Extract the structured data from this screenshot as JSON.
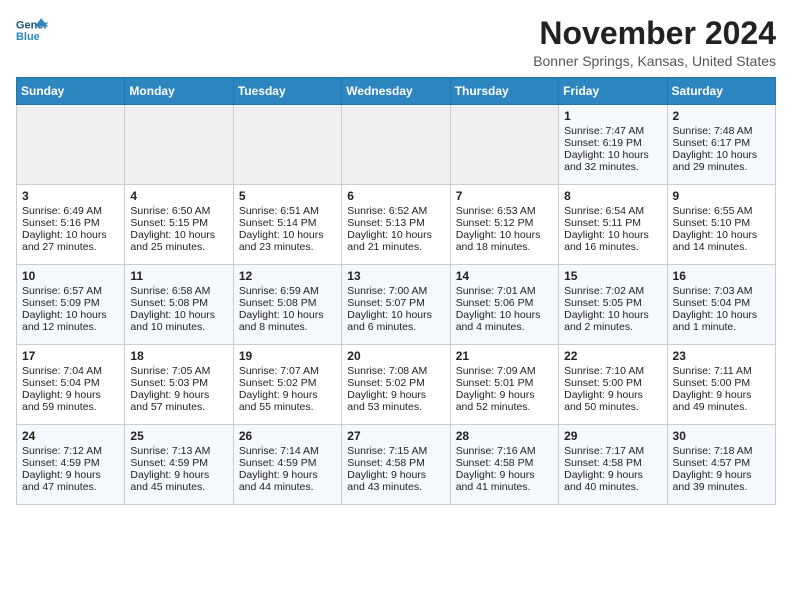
{
  "logo": {
    "line1": "General",
    "line2": "Blue"
  },
  "title": "November 2024",
  "location": "Bonner Springs, Kansas, United States",
  "days_of_week": [
    "Sunday",
    "Monday",
    "Tuesday",
    "Wednesday",
    "Thursday",
    "Friday",
    "Saturday"
  ],
  "weeks": [
    [
      {
        "day": "",
        "empty": true
      },
      {
        "day": "",
        "empty": true
      },
      {
        "day": "",
        "empty": true
      },
      {
        "day": "",
        "empty": true
      },
      {
        "day": "",
        "empty": true
      },
      {
        "day": "1",
        "sunrise": "Sunrise: 7:47 AM",
        "sunset": "Sunset: 6:19 PM",
        "daylight": "Daylight: 10 hours and 32 minutes."
      },
      {
        "day": "2",
        "sunrise": "Sunrise: 7:48 AM",
        "sunset": "Sunset: 6:17 PM",
        "daylight": "Daylight: 10 hours and 29 minutes."
      }
    ],
    [
      {
        "day": "3",
        "sunrise": "Sunrise: 6:49 AM",
        "sunset": "Sunset: 5:16 PM",
        "daylight": "Daylight: 10 hours and 27 minutes."
      },
      {
        "day": "4",
        "sunrise": "Sunrise: 6:50 AM",
        "sunset": "Sunset: 5:15 PM",
        "daylight": "Daylight: 10 hours and 25 minutes."
      },
      {
        "day": "5",
        "sunrise": "Sunrise: 6:51 AM",
        "sunset": "Sunset: 5:14 PM",
        "daylight": "Daylight: 10 hours and 23 minutes."
      },
      {
        "day": "6",
        "sunrise": "Sunrise: 6:52 AM",
        "sunset": "Sunset: 5:13 PM",
        "daylight": "Daylight: 10 hours and 21 minutes."
      },
      {
        "day": "7",
        "sunrise": "Sunrise: 6:53 AM",
        "sunset": "Sunset: 5:12 PM",
        "daylight": "Daylight: 10 hours and 18 minutes."
      },
      {
        "day": "8",
        "sunrise": "Sunrise: 6:54 AM",
        "sunset": "Sunset: 5:11 PM",
        "daylight": "Daylight: 10 hours and 16 minutes."
      },
      {
        "day": "9",
        "sunrise": "Sunrise: 6:55 AM",
        "sunset": "Sunset: 5:10 PM",
        "daylight": "Daylight: 10 hours and 14 minutes."
      }
    ],
    [
      {
        "day": "10",
        "sunrise": "Sunrise: 6:57 AM",
        "sunset": "Sunset: 5:09 PM",
        "daylight": "Daylight: 10 hours and 12 minutes."
      },
      {
        "day": "11",
        "sunrise": "Sunrise: 6:58 AM",
        "sunset": "Sunset: 5:08 PM",
        "daylight": "Daylight: 10 hours and 10 minutes."
      },
      {
        "day": "12",
        "sunrise": "Sunrise: 6:59 AM",
        "sunset": "Sunset: 5:08 PM",
        "daylight": "Daylight: 10 hours and 8 minutes."
      },
      {
        "day": "13",
        "sunrise": "Sunrise: 7:00 AM",
        "sunset": "Sunset: 5:07 PM",
        "daylight": "Daylight: 10 hours and 6 minutes."
      },
      {
        "day": "14",
        "sunrise": "Sunrise: 7:01 AM",
        "sunset": "Sunset: 5:06 PM",
        "daylight": "Daylight: 10 hours and 4 minutes."
      },
      {
        "day": "15",
        "sunrise": "Sunrise: 7:02 AM",
        "sunset": "Sunset: 5:05 PM",
        "daylight": "Daylight: 10 hours and 2 minutes."
      },
      {
        "day": "16",
        "sunrise": "Sunrise: 7:03 AM",
        "sunset": "Sunset: 5:04 PM",
        "daylight": "Daylight: 10 hours and 1 minute."
      }
    ],
    [
      {
        "day": "17",
        "sunrise": "Sunrise: 7:04 AM",
        "sunset": "Sunset: 5:04 PM",
        "daylight": "Daylight: 9 hours and 59 minutes."
      },
      {
        "day": "18",
        "sunrise": "Sunrise: 7:05 AM",
        "sunset": "Sunset: 5:03 PM",
        "daylight": "Daylight: 9 hours and 57 minutes."
      },
      {
        "day": "19",
        "sunrise": "Sunrise: 7:07 AM",
        "sunset": "Sunset: 5:02 PM",
        "daylight": "Daylight: 9 hours and 55 minutes."
      },
      {
        "day": "20",
        "sunrise": "Sunrise: 7:08 AM",
        "sunset": "Sunset: 5:02 PM",
        "daylight": "Daylight: 9 hours and 53 minutes."
      },
      {
        "day": "21",
        "sunrise": "Sunrise: 7:09 AM",
        "sunset": "Sunset: 5:01 PM",
        "daylight": "Daylight: 9 hours and 52 minutes."
      },
      {
        "day": "22",
        "sunrise": "Sunrise: 7:10 AM",
        "sunset": "Sunset: 5:00 PM",
        "daylight": "Daylight: 9 hours and 50 minutes."
      },
      {
        "day": "23",
        "sunrise": "Sunrise: 7:11 AM",
        "sunset": "Sunset: 5:00 PM",
        "daylight": "Daylight: 9 hours and 49 minutes."
      }
    ],
    [
      {
        "day": "24",
        "sunrise": "Sunrise: 7:12 AM",
        "sunset": "Sunset: 4:59 PM",
        "daylight": "Daylight: 9 hours and 47 minutes."
      },
      {
        "day": "25",
        "sunrise": "Sunrise: 7:13 AM",
        "sunset": "Sunset: 4:59 PM",
        "daylight": "Daylight: 9 hours and 45 minutes."
      },
      {
        "day": "26",
        "sunrise": "Sunrise: 7:14 AM",
        "sunset": "Sunset: 4:59 PM",
        "daylight": "Daylight: 9 hours and 44 minutes."
      },
      {
        "day": "27",
        "sunrise": "Sunrise: 7:15 AM",
        "sunset": "Sunset: 4:58 PM",
        "daylight": "Daylight: 9 hours and 43 minutes."
      },
      {
        "day": "28",
        "sunrise": "Sunrise: 7:16 AM",
        "sunset": "Sunset: 4:58 PM",
        "daylight": "Daylight: 9 hours and 41 minutes."
      },
      {
        "day": "29",
        "sunrise": "Sunrise: 7:17 AM",
        "sunset": "Sunset: 4:58 PM",
        "daylight": "Daylight: 9 hours and 40 minutes."
      },
      {
        "day": "30",
        "sunrise": "Sunrise: 7:18 AM",
        "sunset": "Sunset: 4:57 PM",
        "daylight": "Daylight: 9 hours and 39 minutes."
      }
    ]
  ]
}
